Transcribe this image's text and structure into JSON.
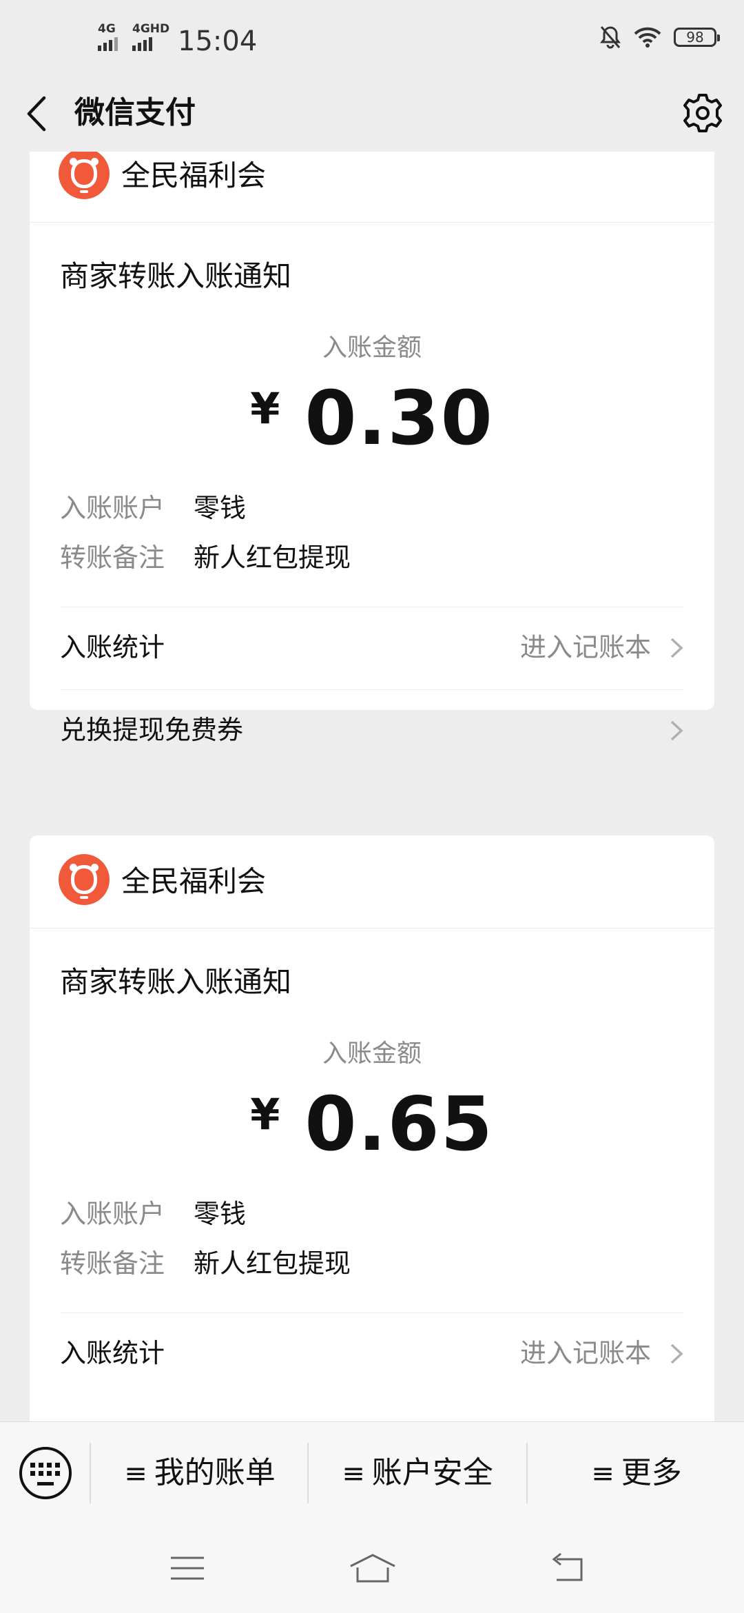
{
  "status_bar": {
    "network_1": "4G",
    "network_2": "4GHD",
    "time": "15:04",
    "battery": "98",
    "icons": [
      "mute-bell-icon",
      "wifi-icon",
      "battery-icon"
    ]
  },
  "header": {
    "title": "微信支付",
    "back_icon": "chevron-left-icon",
    "settings_icon": "gear-icon"
  },
  "cards": [
    {
      "merchant": "全民福利会",
      "notice_title": "商家转账入账通知",
      "amount_label": "入账金额",
      "currency_symbol": "¥",
      "amount": "0.30",
      "fields": [
        {
          "label": "入账账户",
          "value": "零钱"
        },
        {
          "label": "转账备注",
          "value": "新人红包提现"
        }
      ],
      "rows": [
        {
          "label": "入账统计",
          "action": "进入记账本"
        },
        {
          "label": "兑换提现免费券",
          "action": ""
        }
      ]
    },
    {
      "merchant": "全民福利会",
      "notice_title": "商家转账入账通知",
      "amount_label": "入账金额",
      "currency_symbol": "¥",
      "amount": "0.65",
      "fields": [
        {
          "label": "入账账户",
          "value": "零钱"
        },
        {
          "label": "转账备注",
          "value": "新人红包提现"
        }
      ],
      "rows": [
        {
          "label": "入账统计",
          "action": "进入记账本"
        }
      ]
    }
  ],
  "bottom_menu": {
    "keyboard_icon": "keyboard-icon",
    "items": [
      "我的账单",
      "账户安全",
      "更多"
    ],
    "menu_glyph": "≡"
  },
  "system_nav": [
    "menu-icon",
    "home-icon",
    "back-arrow-icon"
  ],
  "colors": {
    "background": "#ededed",
    "card": "#ffffff",
    "logo_accent": "#f0593a",
    "muted_text": "#8a8a8a"
  }
}
